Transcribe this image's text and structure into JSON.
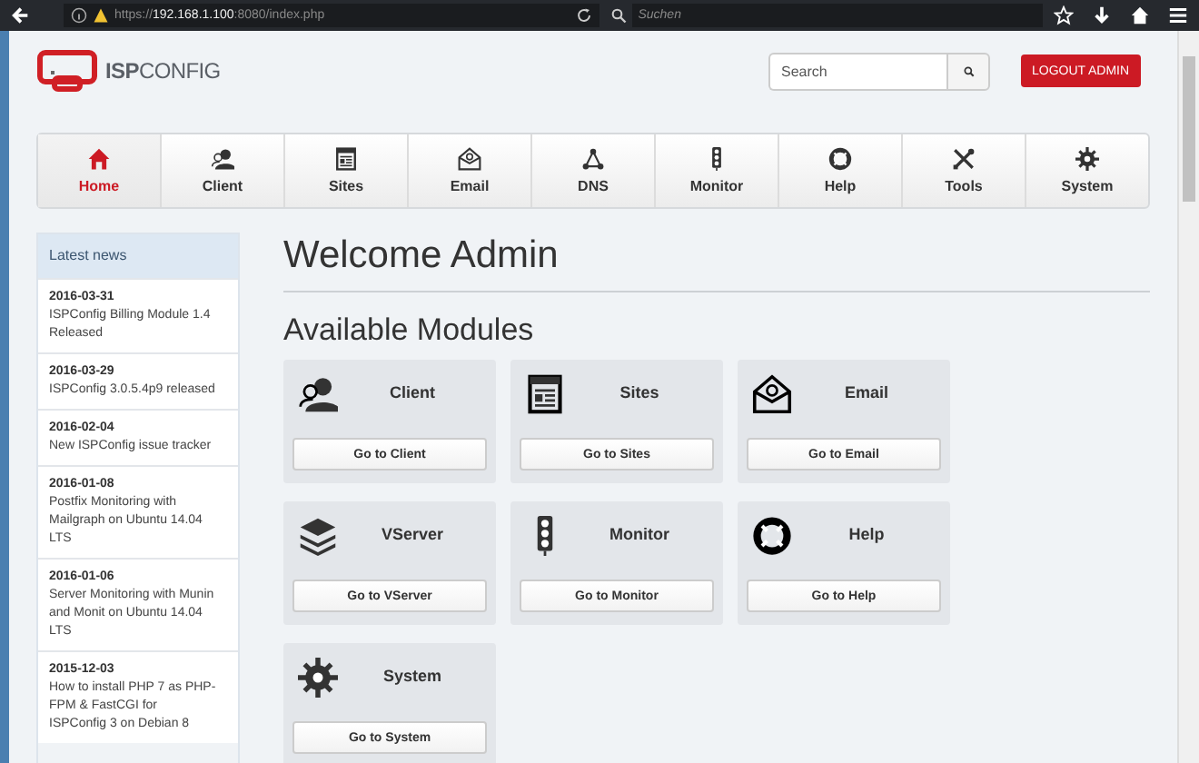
{
  "browser": {
    "url_prefix": "https://",
    "url_host": "192.168.1.100",
    "url_rest": ":8080/index.php",
    "search_placeholder": "Suchen"
  },
  "header": {
    "logo_bold": "ISP",
    "logo_light": "CONFIG",
    "search_placeholder": "Search",
    "logout": "LOGOUT ADMIN"
  },
  "nav": [
    {
      "label": "Home",
      "selected": true
    },
    {
      "label": "Client",
      "selected": false
    },
    {
      "label": "Sites",
      "selected": false
    },
    {
      "label": "Email",
      "selected": false
    },
    {
      "label": "DNS",
      "selected": false
    },
    {
      "label": "Monitor",
      "selected": false
    },
    {
      "label": "Help",
      "selected": false
    },
    {
      "label": "Tools",
      "selected": false
    },
    {
      "label": "System",
      "selected": false
    }
  ],
  "news": {
    "title": "Latest news",
    "items": [
      {
        "date": "2016-03-31",
        "title": "ISPConfig Billing Module 1.4 Released"
      },
      {
        "date": "2016-03-29",
        "title": "ISPConfig 3.0.5.4p9 released"
      },
      {
        "date": "2016-02-04",
        "title": "New ISPConfig issue tracker"
      },
      {
        "date": "2016-01-08",
        "title": "Postfix Monitoring with Mailgraph on Ubuntu 14.04 LTS"
      },
      {
        "date": "2016-01-06",
        "title": "Server Monitoring with Munin and Monit on Ubuntu 14.04 LTS"
      },
      {
        "date": "2015-12-03",
        "title": "How to install PHP 7 as PHP-FPM & FastCGI for ISPConfig 3 on Debian 8"
      }
    ]
  },
  "welcome": "Welcome Admin",
  "modules_title": "Available Modules",
  "modules": [
    {
      "name": "Client",
      "button": "Go to Client"
    },
    {
      "name": "Sites",
      "button": "Go to Sites"
    },
    {
      "name": "Email",
      "button": "Go to Email"
    },
    {
      "name": "VServer",
      "button": "Go to VServer"
    },
    {
      "name": "Monitor",
      "button": "Go to Monitor"
    },
    {
      "name": "Help",
      "button": "Go to Help"
    },
    {
      "name": "System",
      "button": "Go to System"
    }
  ]
}
